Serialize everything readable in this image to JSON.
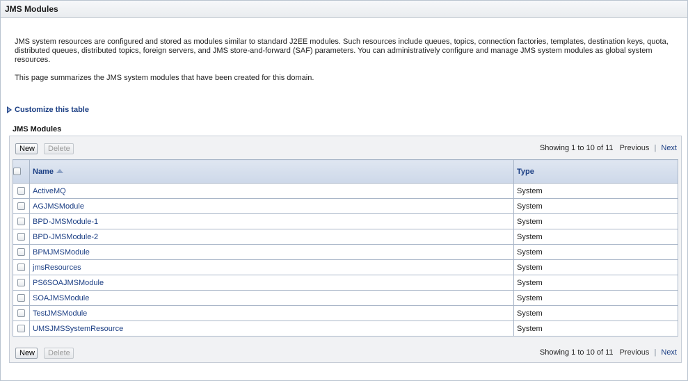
{
  "window": {
    "title": "JMS Modules"
  },
  "intro": {
    "paragraph1": "JMS system resources are configured and stored as modules similar to standard J2EE modules. Such resources include queues, topics, connection factories, templates, destination keys, quota, distributed queues, distributed topics, foreign servers, and JMS store-and-forward (SAF) parameters. You can administratively configure and manage JMS system modules as global system resources.",
    "paragraph2": "This page summarizes the JMS system modules that have been created for this domain."
  },
  "customize": {
    "label": "Customize this table",
    "icon": "expand-triangle-icon"
  },
  "section": {
    "title": "JMS Modules"
  },
  "toolbar": {
    "new_label": "New",
    "delete_label": "Delete",
    "showing": "Showing 1 to 10 of 11",
    "previous": "Previous",
    "next": "Next"
  },
  "table": {
    "columns": {
      "name": "Name",
      "type": "Type"
    },
    "sort_icon": "sort-ascending-icon",
    "rows": [
      {
        "name": "ActiveMQ",
        "type": "System"
      },
      {
        "name": "AGJMSModule",
        "type": "System"
      },
      {
        "name": "BPD-JMSModule-1",
        "type": "System"
      },
      {
        "name": "BPD-JMSModule-2",
        "type": "System"
      },
      {
        "name": "BPMJMSModule",
        "type": "System"
      },
      {
        "name": "jmsResources",
        "type": "System"
      },
      {
        "name": "PS6SOAJMSModule",
        "type": "System"
      },
      {
        "name": "SOAJMSModule",
        "type": "System"
      },
      {
        "name": "TestJMSModule",
        "type": "System"
      },
      {
        "name": "UMSJMSSystemResource",
        "type": "System"
      }
    ]
  },
  "colors": {
    "link": "#1c3f84",
    "header_bg": "#cdd8e9",
    "panel_bg": "#f1f2f4",
    "border": "#a9b6c8"
  }
}
